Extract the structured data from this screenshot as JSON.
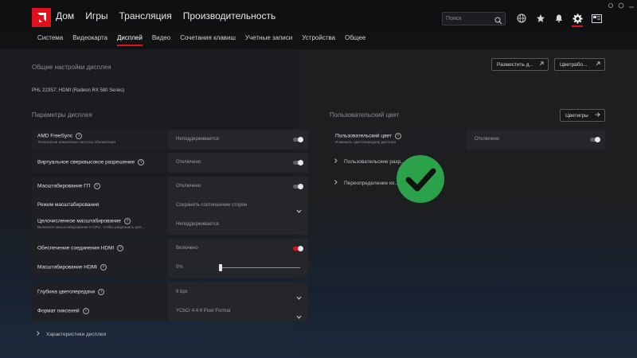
{
  "topnav": {
    "items": [
      "Дом",
      "Игры",
      "Трансляция",
      "Производительность"
    ],
    "search_placeholder": "Поиск"
  },
  "subnav": {
    "items": [
      "Система",
      "Видеокарта",
      "Дисплей",
      "Видео",
      "Сочетания клавиш",
      "Учетные записи",
      "Устройства",
      "Общее"
    ],
    "active": "Дисплей"
  },
  "general": {
    "heading": "Общие настройки дисплея",
    "monitor": "PHL 223S7: HDMI (Radeon RX 580 Series)",
    "btn_layout": "Разместить д...",
    "btn_color": "Цветрабо..."
  },
  "params": {
    "heading": "Параметры дисплея",
    "rows": [
      {
        "name": "AMD FreeSync",
        "sub": "Технология изменения частоты обновления",
        "value": "Неподдерживается",
        "control": "toggle",
        "on": false
      },
      {
        "name": "Виртуальное сверхвысокое разрешение",
        "sub": "",
        "value": "Отключено",
        "control": "toggle",
        "on": false
      },
      {
        "name": "Масштабирование ГП",
        "sub": "",
        "value": "Отключено",
        "control": "toggle",
        "on": false
      },
      {
        "name": "Режим масштабирования",
        "sub": "",
        "value": "Сохранять соотношение сторон",
        "control": "dropdown"
      },
      {
        "name": "Целочисленное масштабирование",
        "sub": "Включите масштабирование в GPU, чтобы разрешить цел...",
        "value": "Неподдерживается",
        "control": "toggle",
        "on": false
      },
      {
        "name": "Обеспечение соединения HDMI",
        "sub": "",
        "value": "Включено",
        "control": "toggle",
        "on": true
      },
      {
        "name": "Масштабирование HDMI",
        "sub": "",
        "value": "0%",
        "control": "slider",
        "level": 0
      },
      {
        "name": "Глубина цветопередачи",
        "sub": "",
        "value": "8 bpc",
        "control": "dropdown"
      },
      {
        "name": "Формат пикселей",
        "sub": "",
        "value": "YCbCr 4:4:4 Pixel Format",
        "control": "dropdown"
      }
    ],
    "expander": "Характеристики дисплея"
  },
  "custom": {
    "heading": "Пользовательский цвет",
    "btn_target": "Цветигры",
    "row_name": "Пользовательский цвет",
    "row_sub": "Изменить цветопередачу дисплея",
    "row_value": "Отключено",
    "expand1": "Пользовательские разр...",
    "expand2": "Переопределение ко...ров"
  },
  "colors": {
    "accent": "#e0101f",
    "check": "#2ba24a"
  },
  "icons": [
    "globe-icon",
    "star-icon",
    "bell-icon",
    "gear-icon",
    "account-icon",
    "search-icon",
    "check-icon"
  ]
}
